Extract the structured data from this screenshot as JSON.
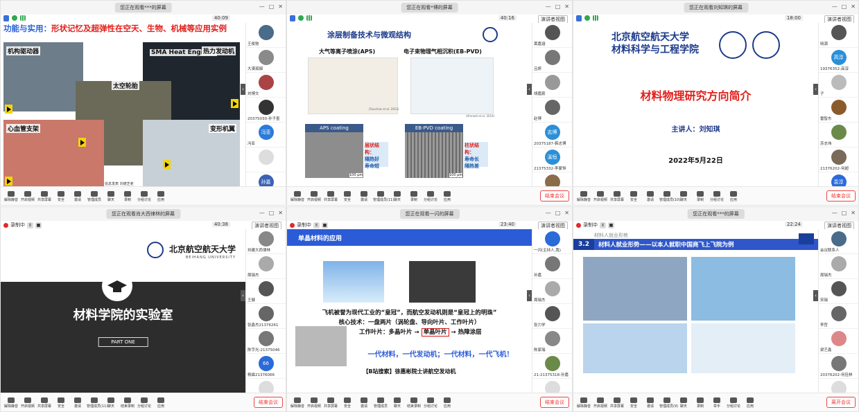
{
  "windows": [
    {
      "share_label": "您正在观看***的屏幕",
      "timer": "40:09",
      "view_label": "",
      "slide": {
        "title_black": "功能与实用：",
        "title_red": "形状记忆及超弹性在空天、生物、机械等应用实例",
        "captions": [
          "机构驱动器",
          "SMA Heat Engines",
          "热力发动机",
          "太空轮胎",
          "心血管支架",
          "变形机翼"
        ],
        "footer": "信息发表    刘德芝老"
      },
      "participants": [
        {
          "name": "王俊驰",
          "color": "#4a6b8a",
          "initial": ""
        },
        {
          "name": "大漠孤烟",
          "color": "#8a8a8a",
          "initial": ""
        },
        {
          "name": "刘博文",
          "color": "#a44",
          "initial": ""
        },
        {
          "name": "20375030-孙子墨",
          "color": "#333",
          "initial": ""
        },
        {
          "name": "冯亚",
          "color": "#2b7bd8",
          "initial": "冯亚"
        },
        {
          "name": "",
          "color": "#ddd",
          "initial": ""
        },
        {
          "name": "21375318-孙嘉",
          "color": "#3a62b5",
          "initial": "孙嘉"
        }
      ],
      "toolbar": [
        "解除静音",
        "开启视频",
        "共享屏幕",
        "安全",
        "邀请",
        "管理成员",
        "聊天",
        "录制",
        "分组讨论",
        "应用"
      ],
      "end_label": ""
    },
    {
      "share_label": "您正在观看*博的屏幕",
      "timer": "40:16",
      "view_label": "演讲者视图",
      "slide": {
        "title": "涂层制备技术与微观结构",
        "aps_title": "大气等离子喷涂(APS)",
        "ebpvd_title": "电子束物理气相沉积(EB-PVD)",
        "aps_coating": "APS coating",
        "ebpvd_coating": "EB-PVD coating",
        "aps_struct": "层状结构：",
        "aps_items": [
          "隔热好",
          "寿命短"
        ],
        "eb_struct": "柱状结构：",
        "eb_items": [
          "寿命长",
          "隔热差"
        ],
        "cite1": "(Fauchais et al. 2013)",
        "cite2": "(Ahmadi et al. 2014)",
        "scale1": "100 μm",
        "scale2": "100 μm"
      },
      "participants": [
        {
          "name": "黄嘉涵",
          "color": "#555",
          "initial": ""
        },
        {
          "name": "吕妍",
          "color": "#777",
          "initial": ""
        },
        {
          "name": "胡嘉宸",
          "color": "#999",
          "initial": ""
        },
        {
          "name": "赵博",
          "color": "#666",
          "initial": ""
        },
        {
          "name": "20375187-韩志博",
          "color": "#2b8fd8",
          "initial": "志博"
        },
        {
          "name": "21375332-李蒙恒",
          "color": "#2b8fd8",
          "initial": "溪恒"
        },
        {
          "name": "",
          "color": "#8a6b4a",
          "initial": ""
        }
      ],
      "toolbar": [
        "解除静音",
        "开启视频",
        "共享屏幕",
        "安全",
        "邀请",
        "管理成员(11)",
        "聊天",
        "录制",
        "分组讨论",
        "应用"
      ],
      "end_label": "结束会议"
    },
    {
      "share_label": "您正在观看刘知琪的屏幕",
      "timer": "18:00",
      "view_label": "演讲者视图",
      "slide": {
        "uni_line1": "北京航空航天大学",
        "uni_line2": "材料科学与工程学院",
        "main_title": "材料物理研究方向简介",
        "speaker": "主讲人：刘知琪",
        "date": "2022年5月22日"
      },
      "participants": [
        {
          "name": "晓源",
          "color": "#555",
          "initial": ""
        },
        {
          "name": "19376352-高淳",
          "color": "#2b8fd8",
          "initial": "高淳"
        },
        {
          "name": "子",
          "color": "#bbb",
          "initial": ""
        },
        {
          "name": "雷智东",
          "color": "#8a5b2a",
          "initial": ""
        },
        {
          "name": "苏志伟",
          "color": "#6b8a4a",
          "initial": ""
        },
        {
          "name": "21376202-何超",
          "color": "#7a6a5a",
          "initial": ""
        },
        {
          "name": "",
          "color": "#2b6bd8",
          "initial": "袁淳"
        }
      ],
      "toolbar": [
        "解除静音",
        "开启视频",
        "共享屏幕",
        "安全",
        "邀请",
        "管理成员(10)",
        "聊天",
        "录制",
        "分组讨论",
        "应用"
      ],
      "end_label": "结束会议"
    },
    {
      "share_label": "您正在观看肖大西律林的屏幕",
      "timer": "40:38",
      "view_label": "演讲者视图",
      "rec_label": "录制中",
      "slide": {
        "uni_name": "北京航空航天大学",
        "uni_sub": "BEIHANG UNIVERSITY",
        "title": "材料学院的实验室",
        "part": "PART ONE"
      },
      "participants": [
        {
          "name": "刘建大西律林",
          "color": "#888",
          "initial": ""
        },
        {
          "name": "周瑞杰",
          "color": "#aaa",
          "initial": ""
        },
        {
          "name": "王健",
          "color": "#555",
          "initial": ""
        },
        {
          "name": "张鑫杰21376261",
          "color": "#666",
          "initial": ""
        },
        {
          "name": "陈宇光-21375046",
          "color": "#777",
          "initial": ""
        },
        {
          "name": "杨霖21376066",
          "color": "#2b6bd8",
          "initial": "66"
        },
        {
          "name": "",
          "color": "#ddd",
          "initial": ""
        }
      ],
      "toolbar": [
        "解除静音",
        "开启视频",
        "共享屏幕",
        "安全",
        "邀请",
        "管理成员(11)",
        "聊天",
        "结束录制",
        "分组讨论",
        "应用"
      ],
      "end_label": "结束会议"
    },
    {
      "share_label": "您正在观看一闪的屏幕",
      "timer": "23:40",
      "view_label": "演讲者视图",
      "rec_label": "录制中",
      "slide": {
        "head": "单晶材料的应用",
        "line1": "飞机被誉为现代工业的“皇冠”，而航空发动机则是“皇冠上的明珠”",
        "line2": "核心技术：一盘两片（涡轮盘、导向叶片、工作叶片）",
        "line3a": "工作叶片：多晶叶片",
        "line3b": "单晶叶片",
        "line3c": "热障涂层",
        "line4": "一代材料，一代发动机；一代材料，一代飞机！",
        "line5": "【B站搜索】徐惠彬院士讲航空发动机"
      },
      "participants": [
        {
          "name": "一闪(主持人,我)",
          "color": "#2b6bd8",
          "initial": ""
        },
        {
          "name": "孙嘉",
          "color": "#777",
          "initial": ""
        },
        {
          "name": "周瑞杰",
          "color": "#aaa",
          "initial": ""
        },
        {
          "name": "张力学",
          "color": "#555",
          "initial": ""
        },
        {
          "name": "陈家瑞",
          "color": "#888",
          "initial": ""
        },
        {
          "name": "21-21375318-孙嘉",
          "color": "#6b8a4a",
          "initial": ""
        },
        {
          "name": "",
          "color": "#ddd",
          "initial": ""
        }
      ],
      "toolbar": [
        "解除静音",
        "开启视频",
        "共享屏幕",
        "安全",
        "邀请",
        "管理成员",
        "聊天",
        "结束录制",
        "分组讨论",
        "应用"
      ],
      "end_label": "结束会议"
    },
    {
      "share_label": "您正在观看***的屏幕",
      "timer": "22:24",
      "view_label": "演讲者视图",
      "rec_label": "录制中",
      "slide": {
        "sub": "材料人就业形势",
        "num": "3.2",
        "title": "材料人就业形势——以本人就职中国商飞上飞院为例"
      },
      "participants": [
        {
          "name": "会议联系人",
          "color": "#4a6b8a",
          "initial": ""
        },
        {
          "name": "周瑞杰",
          "color": "#aaa",
          "initial": ""
        },
        {
          "name": "宋瑞",
          "color": "#555",
          "initial": ""
        },
        {
          "name": "李哲",
          "color": "#666",
          "initial": ""
        },
        {
          "name": "梁艺鑫",
          "color": "#d88",
          "initial": ""
        },
        {
          "name": "20376202-何佳林",
          "color": "#777",
          "initial": ""
        },
        {
          "name": "",
          "color": "#ddd",
          "initial": ""
        }
      ],
      "toolbar": [
        "解除静音",
        "开启视频",
        "共享屏幕",
        "安全",
        "邀请",
        "管理成员(9)",
        "聊天",
        "录制",
        "举手",
        "分组讨论",
        "应用"
      ],
      "end_label": "离开会议"
    }
  ]
}
